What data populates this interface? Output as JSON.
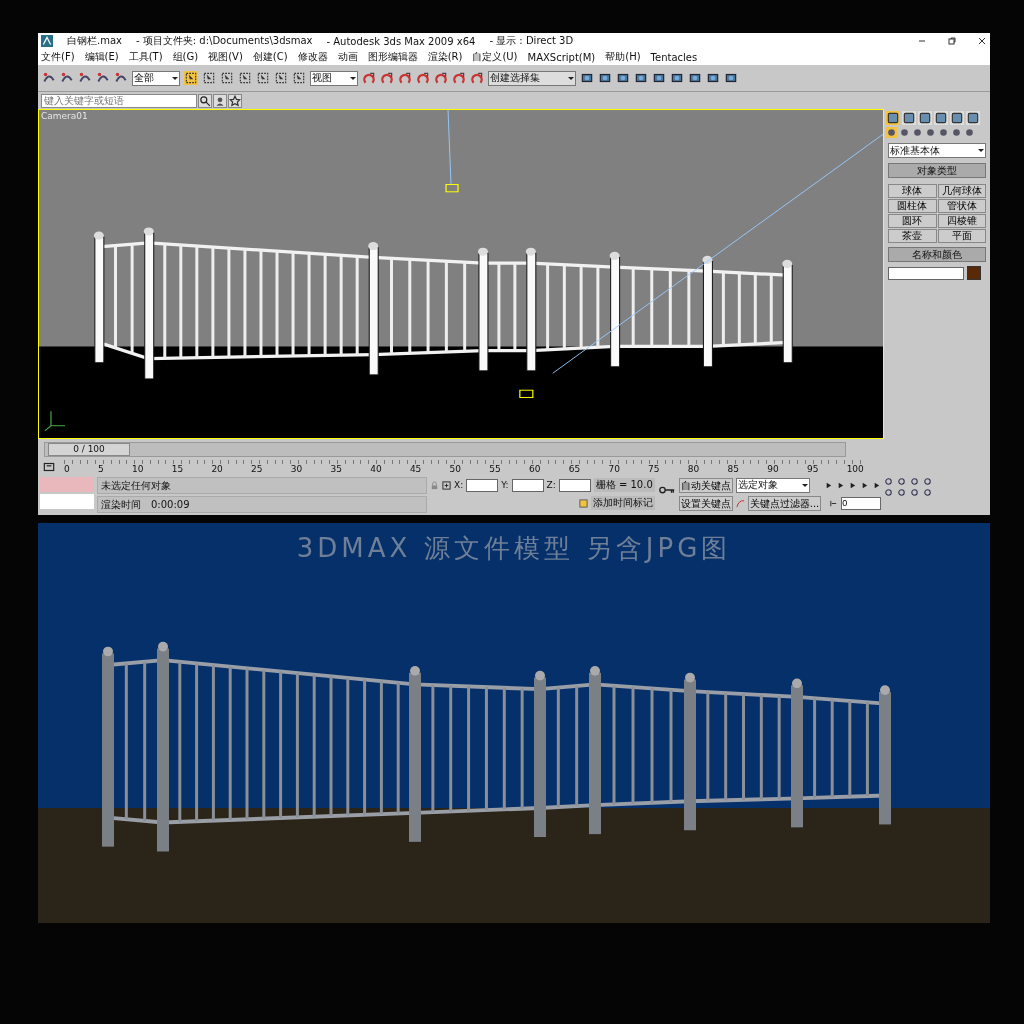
{
  "window": {
    "title": "白钢栏.max",
    "project": "- 项目文件夹: d:\\Documents\\3dsmax",
    "app": "- Autodesk 3ds Max  2009 x64",
    "display": "- 显示 : Direct 3D"
  },
  "menu": [
    "文件(F)",
    "编辑(E)",
    "工具(T)",
    "组(G)",
    "视图(V)",
    "创建(C)",
    "修改器",
    "动画",
    "图形编辑器",
    "渲染(R)",
    "自定义(U)",
    "MAXScript(M)",
    "帮助(H)",
    "Tentacles"
  ],
  "toolbar": {
    "selection_filter": "全部",
    "reference_coord": "视图",
    "named_selection": "创建选择集"
  },
  "search": {
    "placeholder": "键入关键字或短语"
  },
  "viewport": {
    "label": "Camera01"
  },
  "command_panel": {
    "category": "标准基本体",
    "object_type": {
      "title": "对象类型",
      "buttons": [
        "球体",
        "几何球体",
        "圆柱体",
        "管状体",
        "圆环",
        "四棱锥",
        "茶壶",
        "平面"
      ]
    },
    "name_color": {
      "title": "名称和颜色"
    }
  },
  "timeline": {
    "frame": "0 / 100",
    "ticks": [
      "0",
      "5",
      "10",
      "15",
      "20",
      "25",
      "30",
      "35",
      "40",
      "45",
      "50",
      "55",
      "60",
      "65",
      "70",
      "75",
      "80",
      "85",
      "90",
      "95",
      "100"
    ]
  },
  "status": {
    "selection": "未选定任何对象",
    "render_time_label": "渲染时间",
    "render_time": "0:00:09",
    "x": "X:",
    "y": "Y:",
    "z": "Z:",
    "grid": "栅格 = 10.0",
    "add_time_tag": "添加时间标记",
    "auto_key": "自动关键点",
    "set_key": "设置关键点",
    "key_mode": "选定对象",
    "key_filters": "关键点过滤器...",
    "current_frame": "0"
  },
  "render": {
    "caption": "3DMAX 源文件模型 另含JPG图"
  }
}
